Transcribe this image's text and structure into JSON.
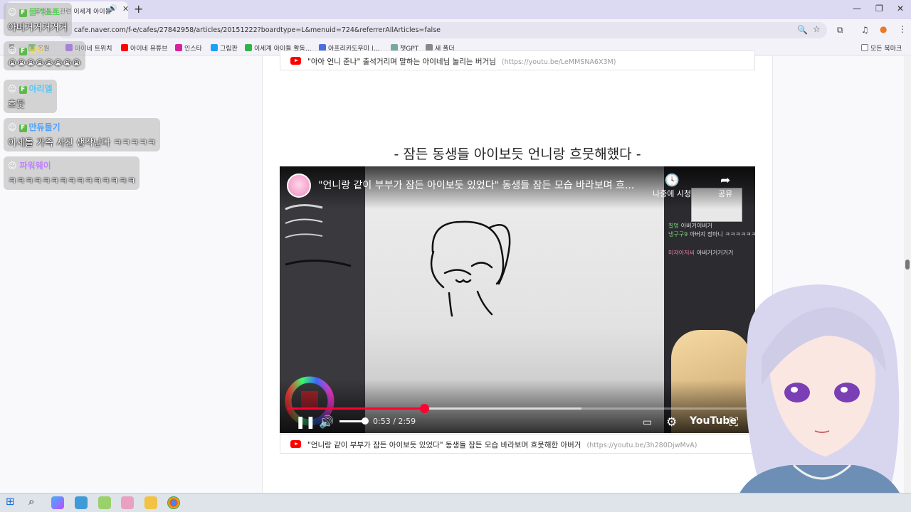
{
  "browser": {
    "tab_title": "동생들과 관련 이세계 아이돌",
    "url": "cafe.naver.com/f-e/cafes/27842958/articles/20151222?boardtype=L&menuid=724&referrerAllArticles=false",
    "bookmarks": [
      {
        "label": "응원",
        "color": "#3dbb5f"
      },
      {
        "label": "아이네 트위치",
        "color": "#9146ff"
      },
      {
        "label": "아이네 유튜브",
        "color": "#ff0000"
      },
      {
        "label": "인스타",
        "color": "#d6249f"
      },
      {
        "label": "그림판",
        "color": "#1da1f2"
      },
      {
        "label": "이세계 아이들 활동...",
        "color": "#2fb44a"
      },
      {
        "label": "아프리카도우미 |...",
        "color": "#4a6ee0"
      },
      {
        "label": "챗GPT",
        "color": "#74aa9c"
      },
      {
        "label": "새 폴더",
        "color": "#888888"
      }
    ],
    "all_bookmarks": "모든 북마크"
  },
  "article": {
    "prev_link_title": "\"아아 언니 준나\" 출석거리며 말하는 아이네님 놀리는 버거님",
    "prev_link_url": "(https://youtu.be/LeMMSNA6X3M)",
    "heading": "- 잠든 동생들 아이보듯 언니랑 흐뭇해했다 -",
    "video": {
      "title": "\"언니랑 같이 부부가 잠든 아이보듯 있었다\" 동생들 잠든 모습 바라보며 흐...",
      "watch_later": "나중에 시청",
      "share": "공유",
      "time": "0:53 / 2:59",
      "progress": 0.296,
      "youtube": "YouTube",
      "chat": [
        {
          "name": "칠멍",
          "text": "아버거이버거"
        },
        {
          "name": "냉구구9",
          "text": "아버지 정마니 ㅋㅋㅋㅋㅋㅋ"
        },
        {
          "name": "미쟈아저씨",
          "text": "아버거거거거거"
        }
      ]
    },
    "link_title": "\"언니랑 같이 부부가 잠든 아이보듯 있었다\" 동생들 잠든 모습 바라보며 흐뭇해한 아버거",
    "link_url": "(https://youtu.be/3h280DjwMvA)"
  },
  "overlay_chat": [
    {
      "name": "돌기스트",
      "text": "아버거거거거거",
      "color": "#5fd35f"
    },
    {
      "name": "낫세",
      "text": "😭😭😭😭😭😭😭😭",
      "color": "#ffd84a"
    },
    {
      "name": "아리엘",
      "text": "흐뭇",
      "color": "#56c8f5"
    },
    {
      "name": "만듀들기",
      "text": "이세돌 가족 사진 생각난다 ㅋㅋㅋㅋㅋ",
      "color": "#4aa0ff"
    },
    {
      "name": "파워웨이",
      "text": "ㅋㅋㅋㅋㅋㅋㅋㅋㅋㅋㅋㅋㅋㅋㅋ",
      "color": "#c080ff"
    }
  ]
}
